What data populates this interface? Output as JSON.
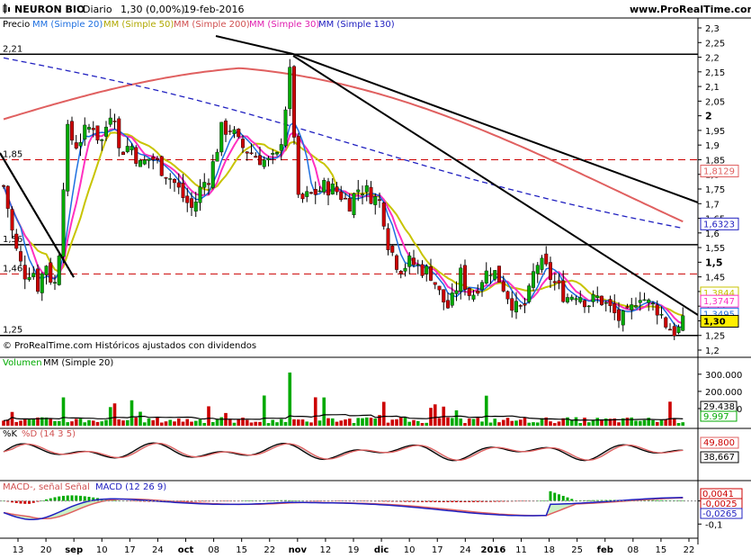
{
  "header": {
    "symbol": "NEURON BIO",
    "period": "Diario",
    "price_change": "1,30 (0,00%)",
    "date": "19-feb-2016",
    "site": "www.ProRealTime.com"
  },
  "copyright": "© ProRealTime.com Históricos ajustados con dividendos",
  "colors": {
    "candle_up": "#00aa00",
    "candle_down": "#cc0000",
    "ma20": "#1e6fe0",
    "ma50": "#c8c400",
    "ma200": "#e06060",
    "ma30": "#ff30c0",
    "ma130": "#2020c0",
    "trendline": "#000000",
    "hline_dashed": "#cc0000"
  },
  "chart_data": [
    {
      "type": "candlestick",
      "panel": "price",
      "legend": [
        "Precio",
        "MM (Simple 20)",
        "MM (Simple 50)",
        "MM (Simple 200)",
        "MM (Simple 30)",
        "MM (Simple 130)"
      ],
      "y_ticks": [
        "2,3",
        "2,25",
        "2,2",
        "2,15",
        "2,1",
        "2,05",
        "2",
        "1,95",
        "1,9",
        "1,85",
        "1,8",
        "1,75",
        "1,7",
        "1,65",
        "1,6",
        "1,55",
        "1,5",
        "1,45",
        "1,4",
        "1,35",
        "1,3",
        "1,25",
        "1,2"
      ],
      "ylim": [
        1.19,
        2.31
      ],
      "price_labels": [
        "2,21",
        "1,85",
        "1,56",
        "1,46",
        "1,25"
      ],
      "last_value_labels": [
        {
          "text": "1,8129",
          "series": "MM (Simple 200)"
        },
        {
          "text": "1,6323",
          "series": "MM (Simple 130)"
        },
        {
          "text": "1,3844",
          "series": "MM (Simple 50)"
        },
        {
          "text": "1,3747",
          "series": "MM (Simple 30)"
        },
        {
          "text": "1,3495",
          "series": "MM (Simple 20)"
        },
        {
          "text": "1,30",
          "series": "Precio"
        }
      ],
      "horizontal_lines": [
        {
          "value": 2.21,
          "style": "solid"
        },
        {
          "value": 1.85,
          "style": "dashed"
        },
        {
          "value": 1.56,
          "style": "solid"
        },
        {
          "value": 1.46,
          "style": "dashed"
        },
        {
          "value": 1.25,
          "style": "solid"
        }
      ],
      "x_labels": [
        "13",
        "20",
        "sep",
        "10",
        "17",
        "24",
        "oct",
        "08",
        "15",
        "22",
        "nov",
        "12",
        "19",
        "dic",
        "10",
        "17",
        "24",
        "2016",
        "11",
        "18",
        "25",
        "feb",
        "08",
        "15",
        "22"
      ]
    },
    {
      "type": "bar",
      "panel": "volume",
      "legend": [
        "Volumen",
        "MM (Simple 20)"
      ],
      "y_ticks": [
        "300.000",
        "200.000",
        "100.000"
      ],
      "ylim": [
        0,
        320000
      ],
      "last_value_labels": [
        "29.438",
        "9.997"
      ]
    },
    {
      "type": "line",
      "panel": "stochastic",
      "legend": [
        "%K",
        "%D (14 3 5)"
      ],
      "last_value_labels": [
        "49,800",
        "38,667"
      ]
    },
    {
      "type": "line",
      "panel": "macd",
      "legend": [
        "MACD-, señal",
        "Señal",
        "MACD (12 26 9)"
      ],
      "y_ticks": [
        "0",
        "-0,1"
      ],
      "last_value_labels": [
        "0,0041",
        "-0,0025",
        "-0,0265"
      ]
    }
  ]
}
